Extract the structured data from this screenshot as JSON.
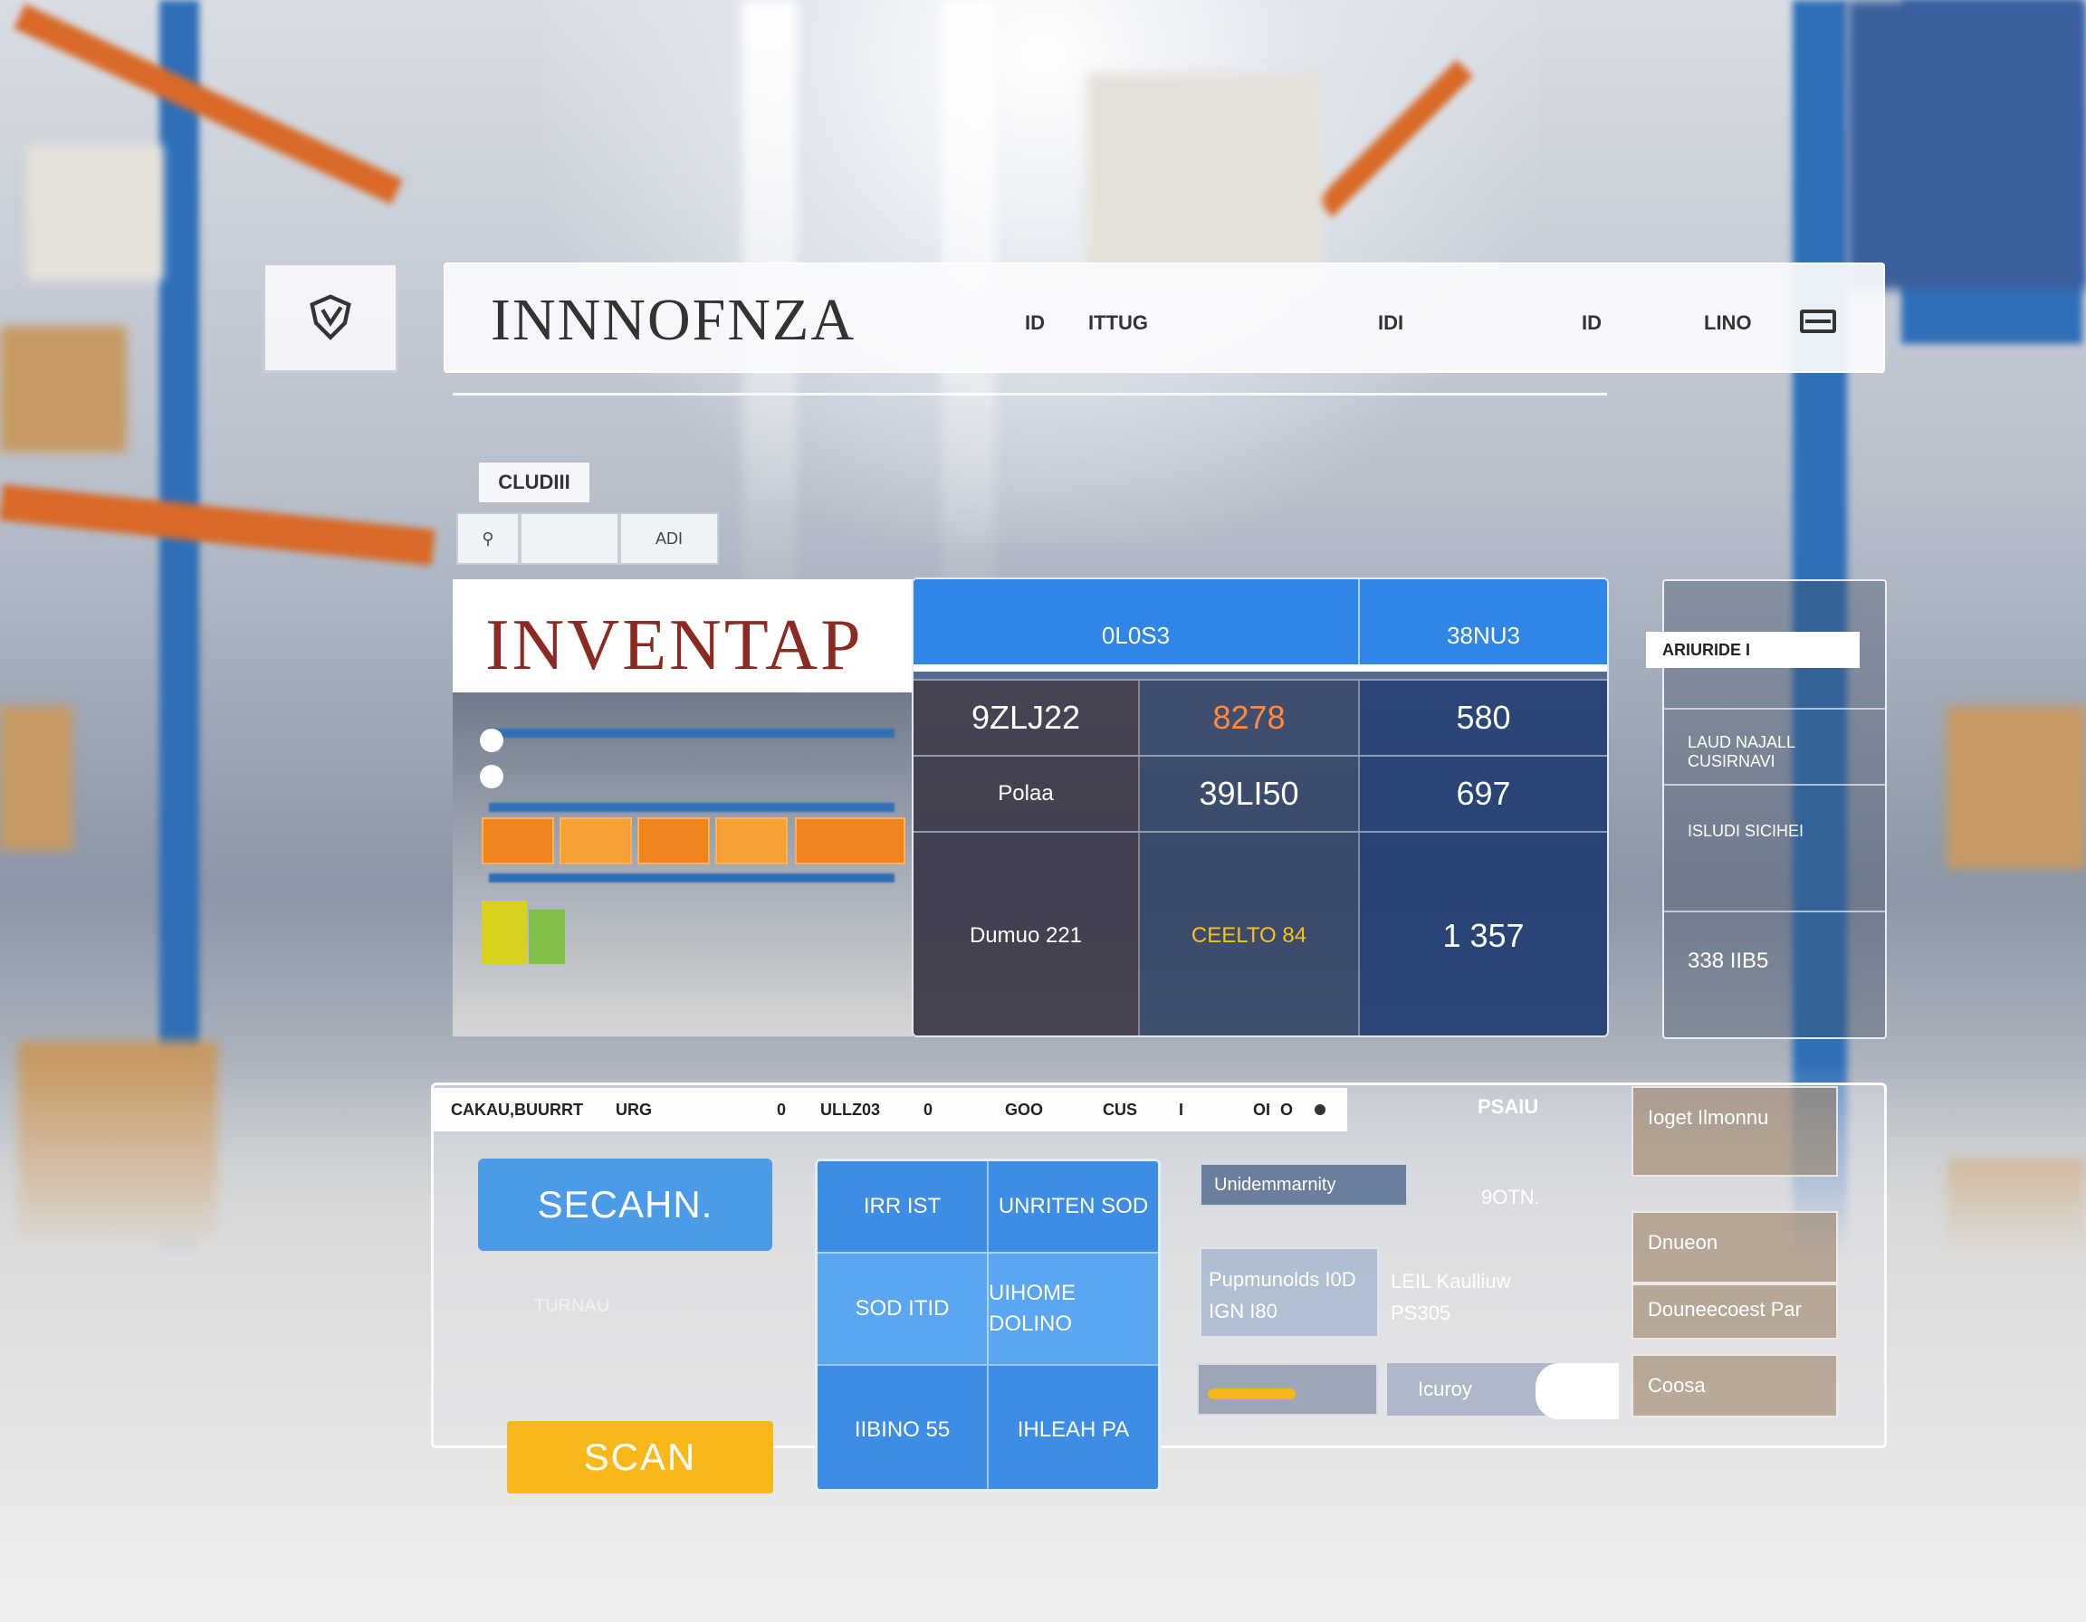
{
  "app": {
    "logo_icon": "shield-icon",
    "title": "INNNOFNZA"
  },
  "header": {
    "nav": [
      "ID",
      "ITTUG",
      "IDI",
      "ID"
    ],
    "user": "LINO",
    "menu_icon": "menu-icon"
  },
  "filter": {
    "label": "CLUDIII",
    "search_icon": "search-icon",
    "search_value": "",
    "search_button": "ADI"
  },
  "inventory": {
    "title": "INVENTAP",
    "table": {
      "headers": [
        "0L0S3",
        "38NU3"
      ],
      "rows": [
        {
          "a": "9ZLJ22",
          "b": "8278",
          "c": "580"
        },
        {
          "a": "Polaa",
          "b": "39LI50",
          "c": "697"
        },
        {
          "a": "Dumuo  221",
          "b": "CEELTO  84",
          "c": "1  357"
        }
      ]
    }
  },
  "side_panel": {
    "label": "ARIURIDE I",
    "cells": [
      "LAUD NAJALL  CUSIRNAVI",
      "ISLUDI  SICIHEI",
      "338  IIB5"
    ]
  },
  "toolbar": {
    "items": [
      "CAKAU,BUURRT",
      "URG",
      "0",
      "ULLZ03",
      "0",
      "GOO",
      "CUS",
      "I",
      "OI",
      "O"
    ]
  },
  "actions": {
    "scan_primary": "SECAHN.",
    "scan_secondary": "SCAN",
    "hint": "TURNAU"
  },
  "grid": {
    "rows": [
      [
        "IRR  IST",
        "UNRITEN  SOD"
      ],
      [
        "SOD  ITID",
        "UIHOME  DOLINO"
      ],
      [
        "IIBINO  55",
        "IHLEAH  PA"
      ]
    ]
  },
  "middle": {
    "label": "Unidemmarnity",
    "top_text_1": "PSAIU",
    "top_text_2": "9OTN.",
    "box": "Pupmunolds  I0D  IGN  I80",
    "side_text": "LEIL Kaulliuw  PS305",
    "progress_fraction": 0.54,
    "pill": "Icuroy"
  },
  "right_column": [
    "Ioget  Ilmonnu",
    "Dnueon",
    "Douneecoest Par",
    "Coosa"
  ],
  "colors": {
    "accent": "#2f86e6",
    "cta": "#f8b81a",
    "title_red": "#8a2a22",
    "orange": "#f0841e"
  }
}
